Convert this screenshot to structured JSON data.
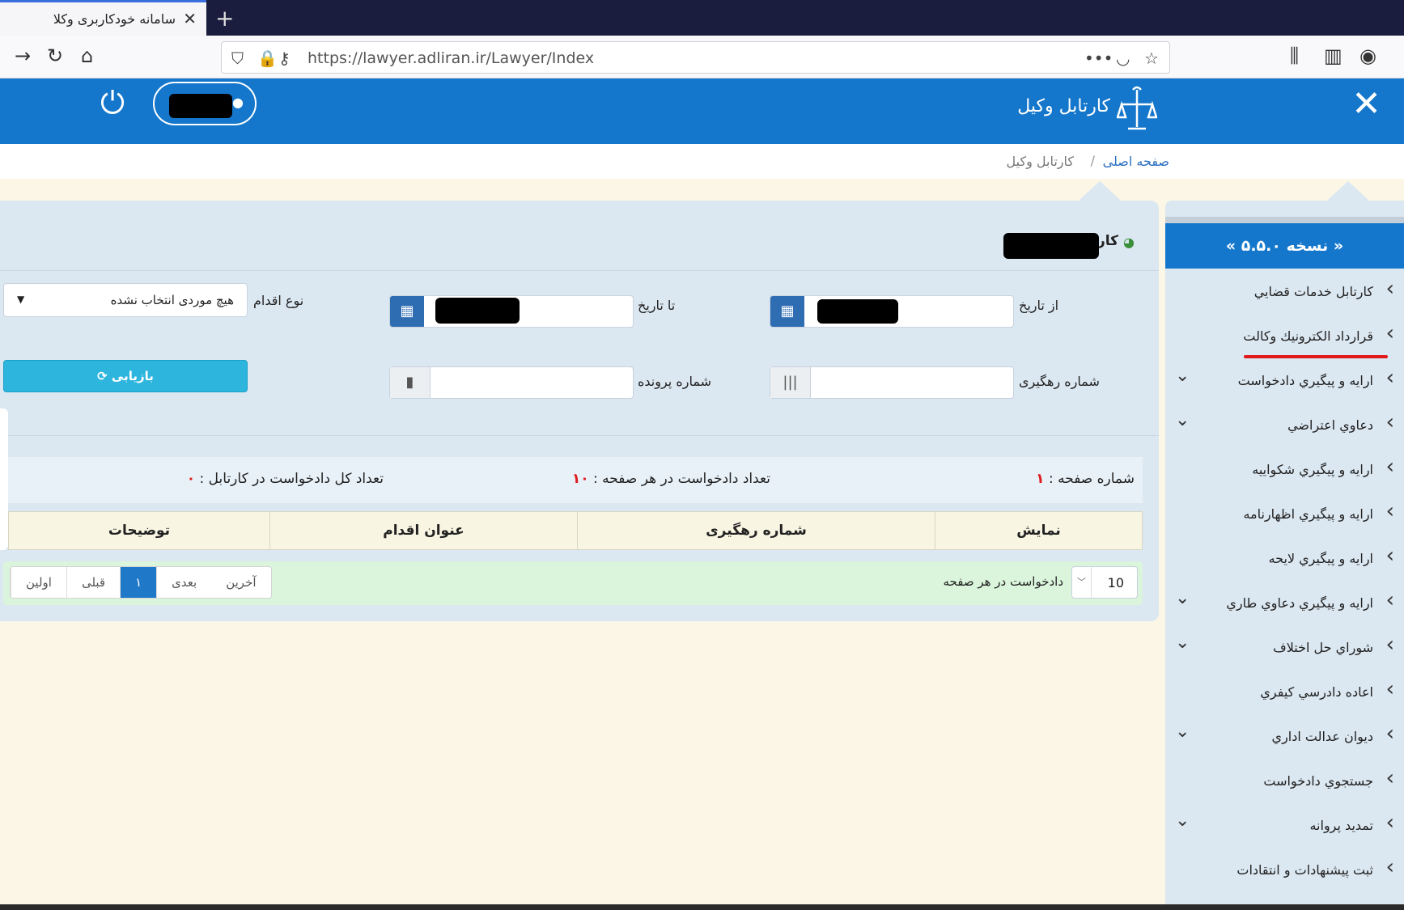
{
  "browser": {
    "tab_title": "سامانه خودکاربری وکلا",
    "url": "https://lawyer.adliran.ir/Lawyer/Index"
  },
  "header": {
    "app_title": "کارتابل وکیل"
  },
  "breadcrumb": {
    "home": "صفحه اصلی",
    "separator": "/",
    "current": "کارتابل وکیل"
  },
  "panel": {
    "title": "کار"
  },
  "filters": {
    "from_date_label": "از تاریخ",
    "to_date_label": "تا تاریخ",
    "action_type_label": "نوع اقدام",
    "action_type_value": "هیچ موردی انتخاب نشده",
    "tracking_label": "شماره رهگیری",
    "case_label": "شماره پرونده",
    "search_button": "بازیابی"
  },
  "stats": {
    "page_number_label": "شماره صفحه :",
    "page_number_value": "۱",
    "per_page_label": "تعداد دادخواست در هر صفحه :",
    "per_page_value": "۱۰",
    "total_label": "تعداد کل دادخواست در کارتابل :",
    "total_value": "۰"
  },
  "table": {
    "columns": [
      "نمایش",
      "شماره رهگیری",
      "عنوان اقدام",
      "توضیحات"
    ]
  },
  "footer": {
    "per_page_select": "10",
    "per_page_label": "دادخواست در هر صفحه",
    "pager": [
      "اولین",
      "قبلی",
      "۱",
      "بعدی",
      "آخرین"
    ]
  },
  "sidebar": {
    "version": "« نسخه ۵.۵.۰ »",
    "items": [
      {
        "label": "کارتابل خدمات قضايي"
      },
      {
        "label": "قرارداد الكترونيك وكالت"
      },
      {
        "label": "ارايه و پيگيري دادخواست"
      },
      {
        "label": "دعاوي اعتراضي"
      },
      {
        "label": "ارايه و پيگيري شكواييه"
      },
      {
        "label": "ارايه و پيگيري اظهارنامه"
      },
      {
        "label": "ارايه و پيگيري لايحه"
      },
      {
        "label": "ارايه و پيگيري دعاوي طاري"
      },
      {
        "label": "شوراي حل اختلاف"
      },
      {
        "label": "اعاده دادرسي كيفري"
      },
      {
        "label": "ديوان عدالت اداري"
      },
      {
        "label": "جستجوي دادخواست"
      },
      {
        "label": "تمديد پروانه"
      },
      {
        "label": "ثبت پيشنهادات و انتقادات"
      }
    ]
  },
  "colors": {
    "brand_blue": "#1477cc",
    "panel_bg": "#dbe7f1",
    "search_button": "#2db5de",
    "highlight_red": "#e01a1a"
  }
}
